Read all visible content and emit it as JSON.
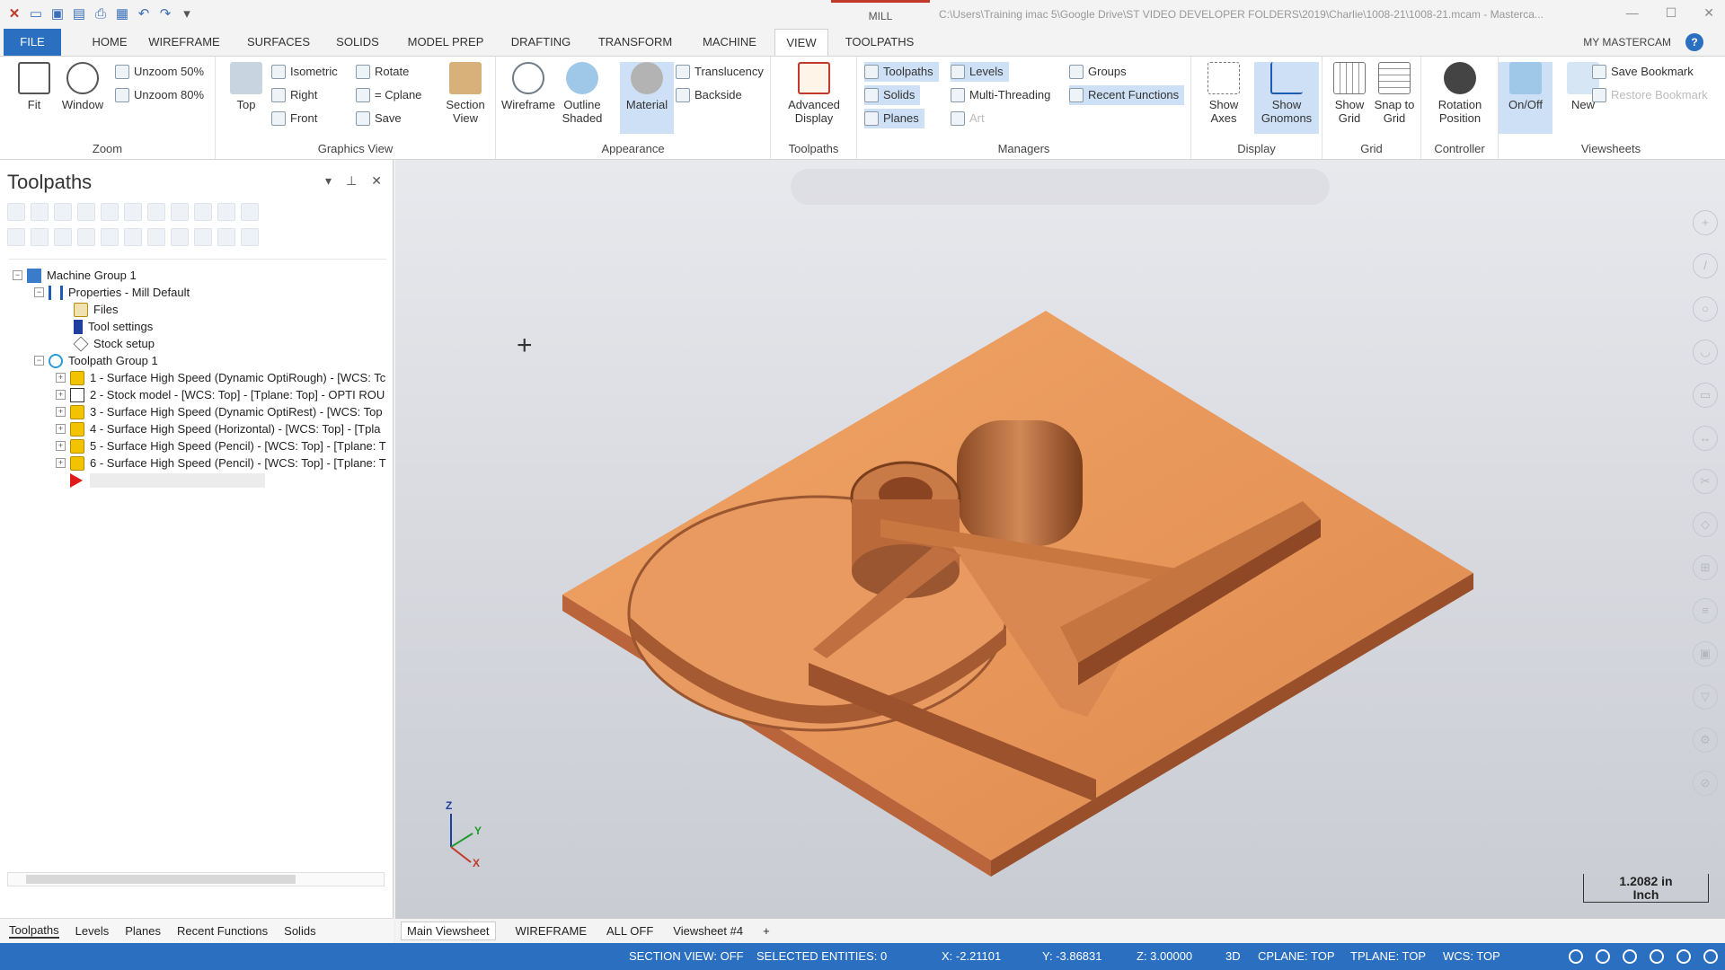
{
  "title_bar": {
    "center_tab": "MILL",
    "file_path": "C:\\Users\\Training imac 5\\Google Drive\\ST VIDEO DEVELOPER FOLDERS\\2019\\Charlie\\1008-21\\1008-21.mcam - Masterca..."
  },
  "menu": {
    "tabs": [
      "FILE",
      "HOME",
      "WIREFRAME",
      "SURFACES",
      "SOLIDS",
      "MODEL PREP",
      "DRAFTING",
      "TRANSFORM",
      "MACHINE",
      "VIEW",
      "TOOLPATHS"
    ],
    "active": "VIEW",
    "my_account": "MY MASTERCAM"
  },
  "ribbon": {
    "zoom": {
      "label": "Zoom",
      "fit": "Fit",
      "window": "Window",
      "unzoom50": "Unzoom 50%",
      "unzoom80": "Unzoom 80%"
    },
    "graphics_view": {
      "label": "Graphics View",
      "top": "Top",
      "isometric": "Isometric",
      "right": "Right",
      "front": "Front",
      "rotate": "Rotate",
      "cplane": "= Cplane",
      "save": "Save",
      "section_view": "Section View"
    },
    "appearance": {
      "label": "Appearance",
      "wireframe": "Wireframe",
      "outline_shaded": "Outline Shaded",
      "material": "Material",
      "translucency": "Translucency",
      "backside": "Backside"
    },
    "toolpaths": {
      "label": "Toolpaths",
      "advanced_display": "Advanced Display"
    },
    "managers": {
      "label": "Managers",
      "toolpaths": "Toolpaths",
      "solids": "Solids",
      "planes": "Planes",
      "levels": "Levels",
      "multi_threading": "Multi-Threading",
      "art": "Art",
      "groups": "Groups",
      "recent_functions": "Recent Functions"
    },
    "display": {
      "label": "Display",
      "show_axes": "Show Axes",
      "show_gnomons": "Show Gnomons"
    },
    "grid": {
      "label": "Grid",
      "show_grid": "Show Grid",
      "snap_to_grid": "Snap to Grid"
    },
    "controller": {
      "label": "Controller",
      "rotation_position": "Rotation Position"
    },
    "viewsheets": {
      "label": "Viewsheets",
      "on_off": "On/Off",
      "new": "New",
      "save_bookmark": "Save Bookmark",
      "restore_bookmark": "Restore Bookmark"
    }
  },
  "toolpaths_panel": {
    "title": "Toolpaths",
    "tree": {
      "machine_group": "Machine Group 1",
      "properties": "Properties - Mill Default",
      "files": "Files",
      "tool_settings": "Tool settings",
      "stock_setup": "Stock setup",
      "toolpath_group": "Toolpath Group 1",
      "ops": [
        "1 - Surface High Speed (Dynamic OptiRough) - [WCS: Tc",
        "2 - Stock model - [WCS: Top] - [Tplane: Top] - OPTI ROU",
        "3 - Surface High Speed (Dynamic OptiRest) - [WCS: Top",
        "4 - Surface High Speed (Horizontal) - [WCS: Top] - [Tpla",
        "5 - Surface High Speed (Pencil) - [WCS: Top] - [Tplane: T",
        "6 - Surface High Speed (Pencil) - [WCS: Top] - [Tplane: T"
      ]
    },
    "bottom_tabs": [
      "Toolpaths",
      "Levels",
      "Planes",
      "Recent Functions",
      "Solids"
    ]
  },
  "viewport": {
    "scale_value": "1.2082 in",
    "scale_unit": "Inch",
    "axis_z": "Z",
    "axis_y": "Y",
    "axis_x": "X"
  },
  "viewsheet_tabs": [
    "Main Viewsheet",
    "WIREFRAME",
    "ALL OFF",
    "Viewsheet #4",
    "+"
  ],
  "status": {
    "section_view": "SECTION VIEW: OFF",
    "selected": "SELECTED ENTITIES: 0",
    "x": "X:   -2.21101",
    "y": "Y:   -3.86831",
    "z": "Z:   3.00000",
    "mode": "3D",
    "cplane": "CPLANE: TOP",
    "tplane": "TPLANE: TOP",
    "wcs": "WCS: TOP"
  },
  "colors": {
    "accent": "#2a6fc0",
    "part": "#e8965a",
    "status_bar": "#2a6fc0"
  }
}
